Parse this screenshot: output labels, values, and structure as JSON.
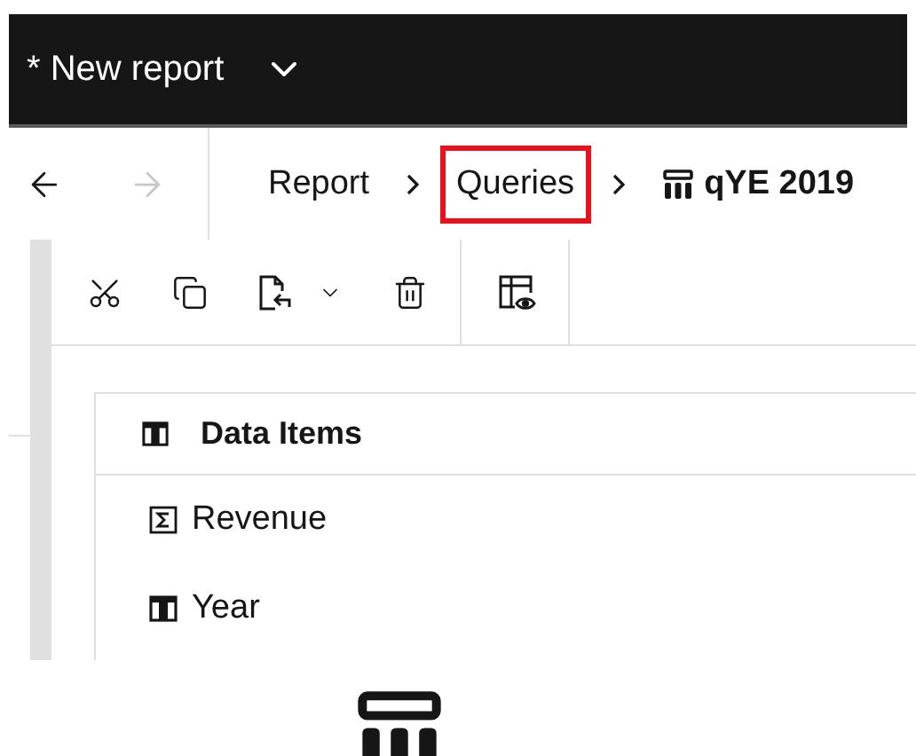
{
  "header": {
    "title": "* New report",
    "menu_expanded": false
  },
  "navigation": [
    {
      "kind": "back",
      "disabled": false
    },
    {
      "kind": "forward",
      "disabled": true
    }
  ],
  "breadcrumbs": [
    {
      "label": "Report",
      "current": false,
      "highlighted": false
    },
    {
      "label": "Queries",
      "current": false,
      "highlighted": true
    },
    {
      "label": "qYE 2019",
      "current": true,
      "highlighted": false
    }
  ],
  "toolbar": [
    [
      {
        "kind": "cut"
      },
      {
        "kind": "copy"
      },
      {
        "kind": "paste"
      },
      {
        "kind": "delete"
      }
    ],
    [
      {
        "kind": "preview"
      }
    ]
  ],
  "data_items": {
    "title": "Data Items",
    "items": [
      {
        "label": "Revenue",
        "kind": "measure"
      },
      {
        "label": "Year",
        "kind": "attribute"
      }
    ]
  }
}
